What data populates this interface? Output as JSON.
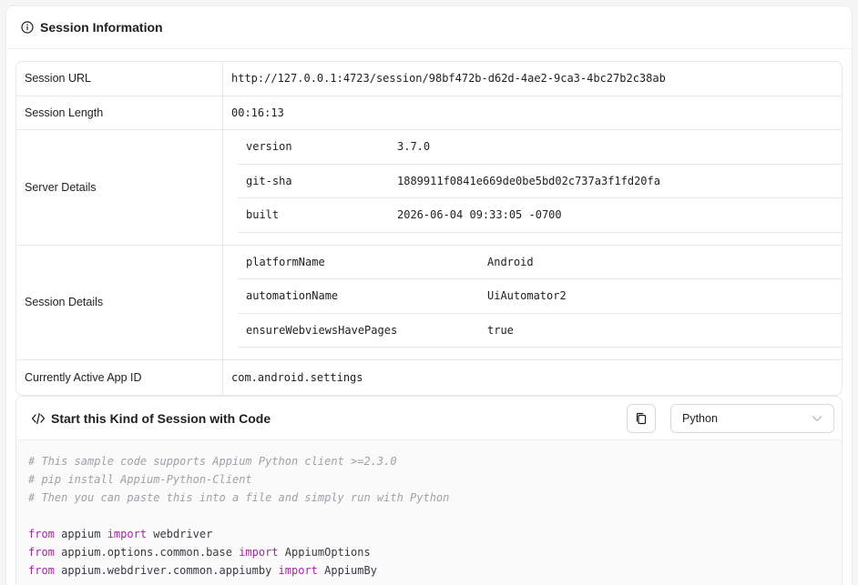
{
  "header": {
    "title": "Session Information",
    "icon": "info-icon"
  },
  "info": {
    "session_url": {
      "label": "Session URL",
      "value": "http://127.0.0.1:4723/session/98bf472b-d62d-4ae2-9ca3-4bc27b2c38ab"
    },
    "session_length": {
      "label": "Session Length",
      "value": "00:16:13"
    },
    "server_details": {
      "label": "Server Details",
      "rows": [
        {
          "key": "version",
          "value": "3.7.0"
        },
        {
          "key": "git-sha",
          "value": "1889911f0841e669de0be5bd02c737a3f1fd20fa"
        },
        {
          "key": "built",
          "value": "2026-06-04 09:33:05 -0700"
        }
      ]
    },
    "session_details": {
      "label": "Session Details",
      "rows": [
        {
          "key": "platformName",
          "value": "Android"
        },
        {
          "key": "automationName",
          "value": "UiAutomator2"
        },
        {
          "key": "ensureWebviewsHavePages",
          "value": "true"
        }
      ]
    },
    "active_app": {
      "label": "Currently Active App ID",
      "value": "com.android.settings"
    }
  },
  "code": {
    "title": "Start this Kind of Session with Code",
    "icon": "code-icon",
    "copy_icon": "copy-icon",
    "language": "Python",
    "lines": {
      "c1": "# This sample code supports Appium Python client >=2.3.0",
      "c2": "# pip install Appium-Python-Client",
      "c3": "# Then you can paste this into a file and simply run with Python",
      "l5": {
        "from": "from",
        "mod": " appium ",
        "imp": "import",
        "name": " webdriver"
      },
      "l6": {
        "from": "from",
        "mod": " appium.options.common.base ",
        "imp": "import",
        "name": " AppiumOptions"
      },
      "l7": {
        "from": "from",
        "mod": " appium.webdriver.common.appiumby ",
        "imp": "import",
        "name": " AppiumBy"
      }
    }
  },
  "colors": {
    "keyword": "#a626a4",
    "comment": "#a0a1a7",
    "border": "#e8e8e8"
  }
}
